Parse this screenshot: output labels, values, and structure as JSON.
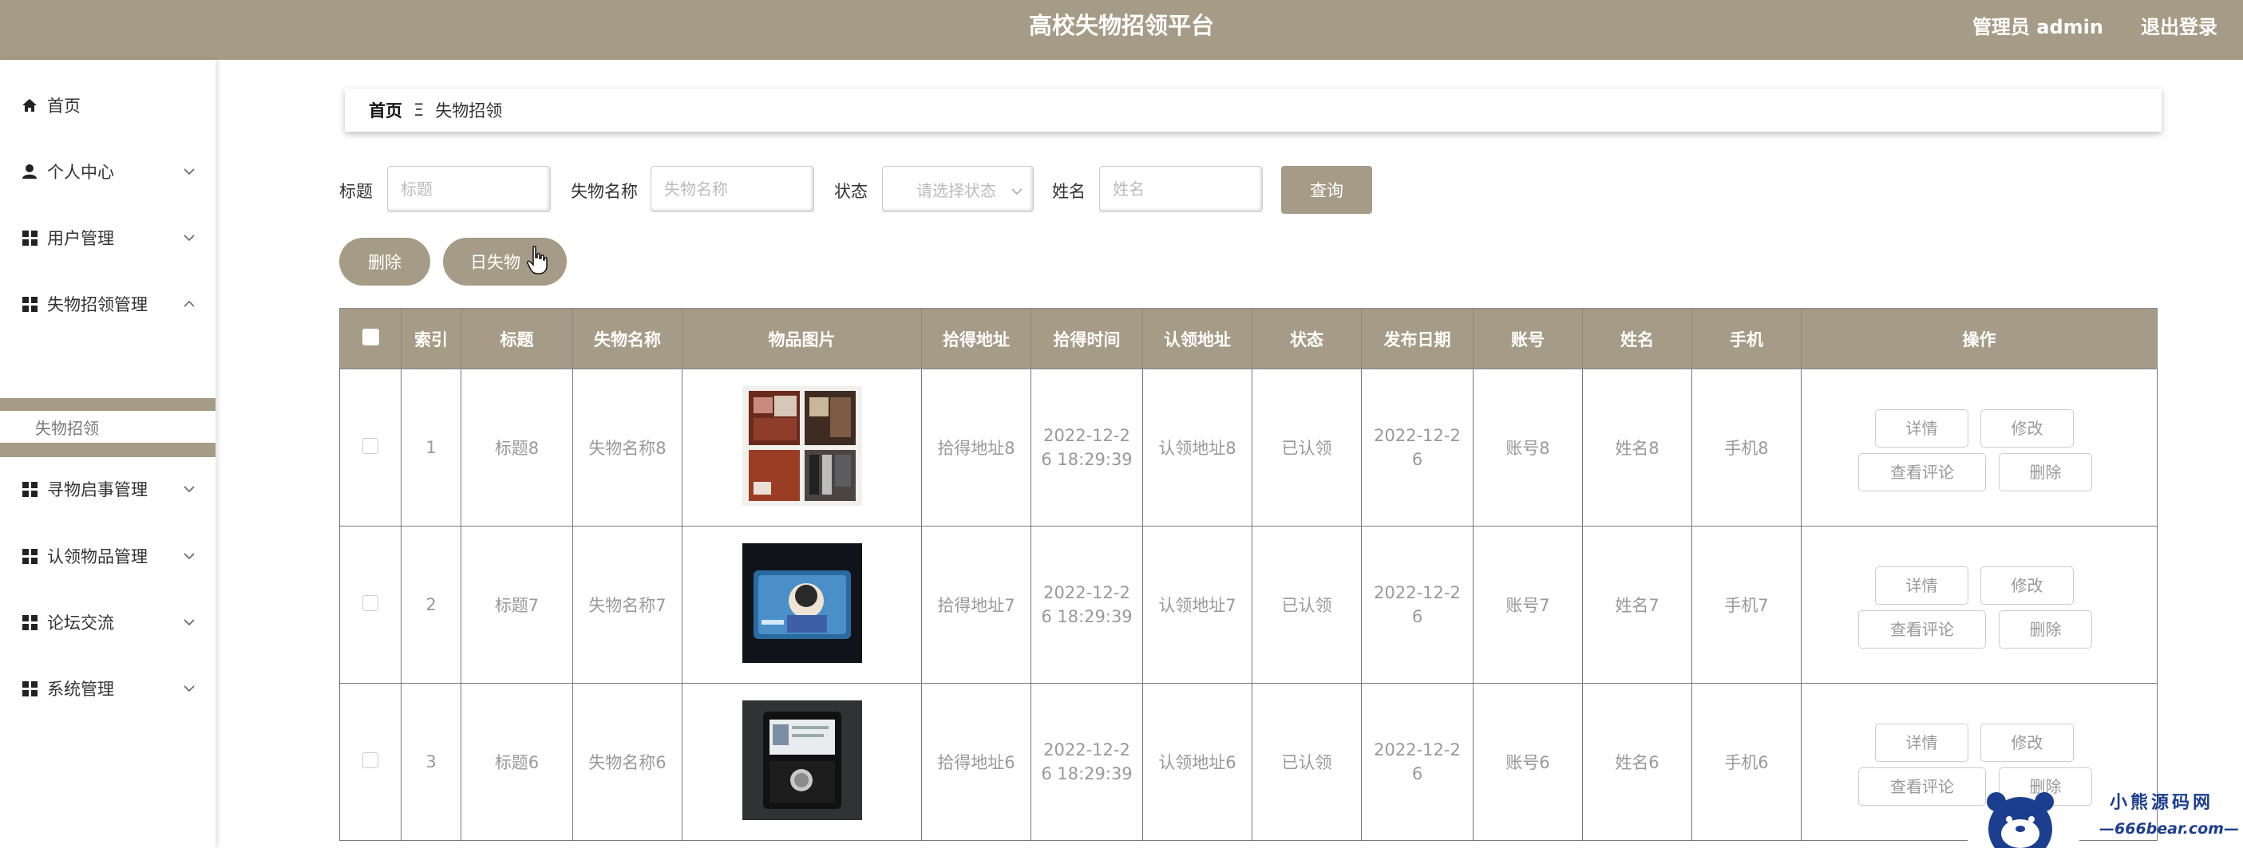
{
  "header": {
    "title": "高校失物招领平台",
    "admin_label": "管理员 admin",
    "logout_label": "退出登录"
  },
  "sidebar": {
    "items": [
      {
        "label": "首页",
        "icon": "home-icon"
      },
      {
        "label": "个人中心",
        "icon": "user-icon"
      },
      {
        "label": "用户管理",
        "icon": "grid-icon"
      },
      {
        "label": "失物招领管理",
        "icon": "grid-icon",
        "expanded": true
      },
      {
        "label": "寻物启事管理",
        "icon": "grid-icon"
      },
      {
        "label": "认领物品管理",
        "icon": "grid-icon"
      },
      {
        "label": "论坛交流",
        "icon": "grid-icon"
      },
      {
        "label": "系统管理",
        "icon": "grid-icon"
      }
    ],
    "active_sub": "失物招领"
  },
  "breadcrumb": {
    "home": "首页",
    "separator": "Ξ",
    "current": "失物招领"
  },
  "search": {
    "title_label": "标题",
    "title_placeholder": "标题",
    "item_label": "失物名称",
    "item_placeholder": "失物名称",
    "status_label": "状态",
    "status_placeholder": "请选择状态",
    "name_label": "姓名",
    "name_placeholder": "姓名",
    "query_label": "查询"
  },
  "actions": {
    "delete_label": "删除",
    "chart_label": "日失物"
  },
  "table": {
    "headers": [
      "",
      "索引",
      "标题",
      "失物名称",
      "物品图片",
      "拾得地址",
      "拾得时间",
      "认领地址",
      "状态",
      "发布日期",
      "账号",
      "姓名",
      "手机",
      "操作"
    ],
    "rows": [
      {
        "index": "1",
        "title": "标题8",
        "item": "失物名称8",
        "address": "拾得地址8",
        "time_line1": "2022-12-2",
        "time_line2": "6 18:29:39",
        "claim_address": "认领地址8",
        "status": "已认领",
        "date_line1": "2022-12-2",
        "date_line2": "6",
        "account": "账号8",
        "name": "姓名8",
        "phone": "手机8"
      },
      {
        "index": "2",
        "title": "标题7",
        "item": "失物名称7",
        "address": "拾得地址7",
        "time_line1": "2022-12-2",
        "time_line2": "6 18:29:39",
        "claim_address": "认领地址7",
        "status": "已认领",
        "date_line1": "2022-12-2",
        "date_line2": "6",
        "account": "账号7",
        "name": "姓名7",
        "phone": "手机7"
      },
      {
        "index": "3",
        "title": "标题6",
        "item": "失物名称6",
        "address": "拾得地址6",
        "time_line1": "2022-12-2",
        "time_line2": "6 18:29:39",
        "claim_address": "认领地址6",
        "status": "已认领",
        "date_line1": "2022-12-2",
        "date_line2": "6",
        "account": "账号6",
        "name": "姓名6",
        "phone": "手机6"
      }
    ],
    "ops": {
      "detail": "详情",
      "edit": "修改",
      "comments": "查看评论",
      "delete": "删除"
    }
  },
  "watermark": {
    "line1": "小熊源码网",
    "line2": "—666bear.com—"
  },
  "colors": {
    "accent": "#a69b86",
    "watermark": "#1b3e8f"
  }
}
